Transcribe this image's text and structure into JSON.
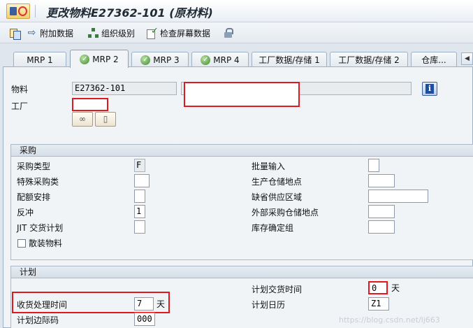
{
  "window": {
    "title": "更改物料E27362-101 (原材料)"
  },
  "toolbar": {
    "additional_data": "附加数据",
    "org_levels": "组织级别",
    "check_screen_data": "检查屏幕数据"
  },
  "tabs": [
    "MRP 1",
    "MRP 2",
    "MRP 3",
    "MRP 4",
    "工厂数据/存储 1",
    "工厂数据/存储 2",
    "仓库..."
  ],
  "header": {
    "material_label": "物料",
    "material_value": "E27362-101",
    "material_desc": "",
    "plant_label": "工厂",
    "plant_value": ""
  },
  "procurement": {
    "section_title": "采购",
    "procurement_type_label": "采购类型",
    "procurement_type_value": "F",
    "special_procurement_label": "特殊采购类",
    "special_procurement_value": "",
    "quota_label": "配额安排",
    "quota_value": "",
    "backflush_label": "反冲",
    "backflush_value": "1",
    "jit_label": "JIT 交货计划",
    "jit_value": "",
    "bulk_label": "散装物料",
    "batch_entry_label": "批量输入",
    "batch_entry_value": "",
    "prod_stor_loc_label": "生产仓储地点",
    "prod_stor_loc_value": "",
    "default_supply_area_label": "缺省供应区域",
    "default_supply_area_value": "",
    "ext_proc_stor_loc_label": "外部采购仓储地点",
    "ext_proc_stor_loc_value": "",
    "stock_det_group_label": "库存确定组",
    "stock_det_group_value": ""
  },
  "planning": {
    "section_title": "计划",
    "planned_delivery_label": "计划交货时间",
    "planned_delivery_value": "0",
    "planned_delivery_unit": "天",
    "gr_processing_label": "收货处理时间",
    "gr_processing_value": "7",
    "gr_processing_unit": "天",
    "planning_calendar_label": "计划日历",
    "planning_calendar_value": "Z1",
    "sched_margin_label": "计划边际码",
    "sched_margin_value": "000"
  },
  "watermark": "https://blog.csdn.net/lj663",
  "colors": {
    "highlight_red": "#e1181d",
    "background": "#dfe6ee"
  }
}
